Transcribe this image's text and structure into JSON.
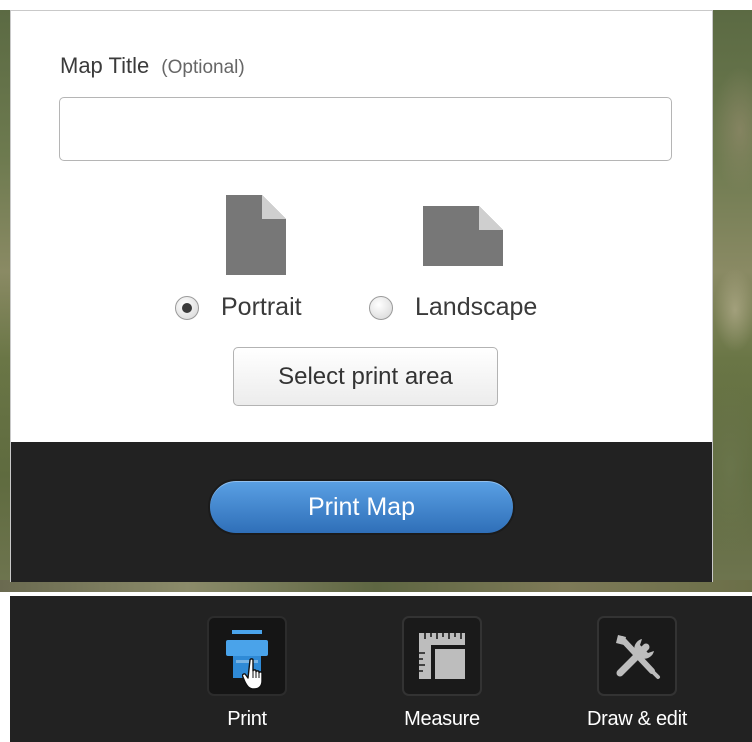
{
  "print_panel": {
    "title_label": "Map Title",
    "title_optional": "(Optional)",
    "title_value": "",
    "orientation": {
      "portrait_label": "Portrait",
      "landscape_label": "Landscape",
      "selected": "portrait"
    },
    "select_area_label": "Select print area",
    "print_button_label": "Print Map"
  },
  "toolbar": {
    "tools": [
      {
        "label": "Print",
        "icon": "printer-icon",
        "active": true
      },
      {
        "label": "Measure",
        "icon": "ruler-icon",
        "active": false
      },
      {
        "label": "Draw & edit",
        "icon": "tools-icon",
        "active": false
      }
    ]
  },
  "colors": {
    "accent_blue": "#3a7fcc",
    "toolbar_bg": "#222222",
    "page_icon_gray": "#777777"
  }
}
